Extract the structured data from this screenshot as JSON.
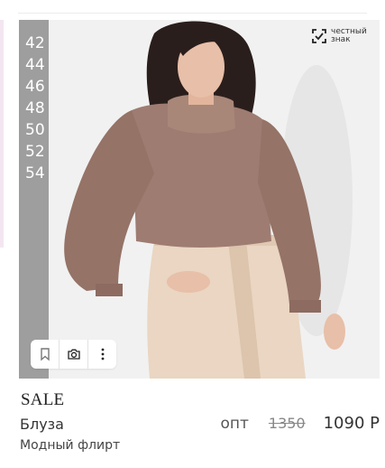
{
  "product": {
    "sale_label": "SALE",
    "name": "Блуза",
    "brand": "Модный флирт",
    "price_kind": "опт",
    "old_price": "1350",
    "new_price": "1090 Р",
    "sizes": [
      "42",
      "44",
      "46",
      "48",
      "50",
      "52",
      "54"
    ],
    "photo_alt": "Блуза Модный флирт"
  },
  "honest_mark": {
    "line1": "честный",
    "line2": "знак",
    "icon": "honest-mark-logo"
  },
  "actions": [
    {
      "name": "bookmark",
      "icon": "bookmark-icon"
    },
    {
      "name": "camera",
      "icon": "camera-icon"
    },
    {
      "name": "more",
      "icon": "more-vertical-icon"
    }
  ],
  "colors": {
    "size_bar": "#9e9e9e",
    "blouse": "#9e7c72",
    "skirt": "#ead6c2",
    "hair": "#2a1e1c",
    "skin": "#e8bfa8",
    "background": "#f1f1f1"
  }
}
